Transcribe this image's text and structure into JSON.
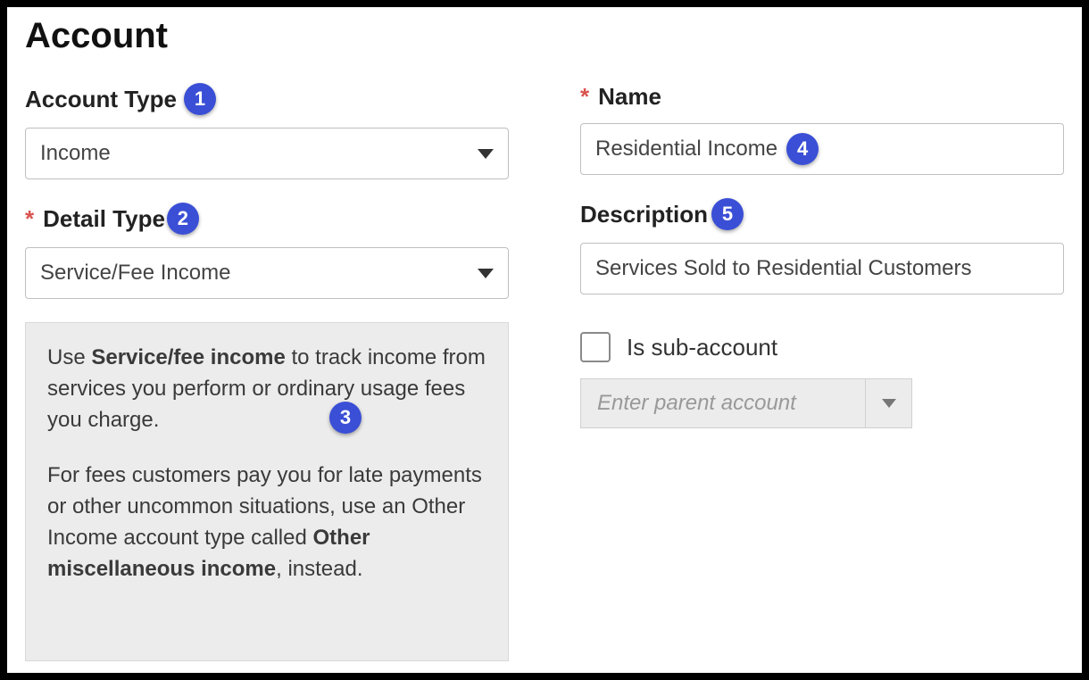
{
  "heading": "Account",
  "badges": {
    "b1": "1",
    "b2": "2",
    "b3": "3",
    "b4": "4",
    "b5": "5"
  },
  "labels": {
    "account_type": "Account Type",
    "detail_type": "Detail Type",
    "name": "Name",
    "description": "Description",
    "sub_account": "Is sub-account"
  },
  "fields": {
    "account_type_value": "Income",
    "detail_type_value": "Service/Fee Income",
    "name_value": "Residential Income",
    "description_value": "Services Sold to Residential Customers",
    "parent_account_placeholder": "Enter parent account"
  },
  "helptext": {
    "p1_pre": "Use ",
    "p1_bold": "Service/fee income",
    "p1_post": " to track income from services you perform or ordinary usage fees you charge.",
    "p2_pre": "For fees customers pay you for late payments or other uncommon situations, use an Other Income account type called ",
    "p2_bold": "Other miscellaneous income",
    "p2_post": ", instead."
  }
}
